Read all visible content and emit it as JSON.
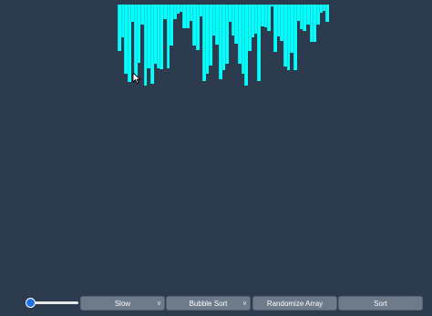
{
  "visualizer": {
    "bar_color": "#00ffff",
    "background_color": "#2d3b4f",
    "bar_levels": [
      54,
      38,
      80,
      89,
      20,
      84,
      67,
      23,
      94,
      74,
      92,
      68,
      74,
      75,
      17,
      74,
      47,
      17,
      10,
      8,
      27,
      27,
      19,
      47,
      53,
      14,
      88,
      80,
      70,
      36,
      46,
      86,
      76,
      68,
      20,
      36,
      45,
      68,
      80,
      94,
      54,
      38,
      34,
      88,
      25,
      26,
      30,
      0,
      55,
      37,
      42,
      71,
      76,
      56,
      76,
      19,
      28,
      31,
      23,
      43,
      43,
      23,
      9,
      7,
      20
    ]
  },
  "cursor": {
    "icon": "mouse-pointer-icon"
  },
  "controls": {
    "speed_slider": {
      "value_fraction": 0.0
    },
    "speed_select": {
      "value": "Slow"
    },
    "algorithm_select": {
      "value": "Bubble Sort"
    },
    "randomize_button": {
      "label": "Randomize Array"
    },
    "sort_button": {
      "label": "Sort"
    }
  }
}
